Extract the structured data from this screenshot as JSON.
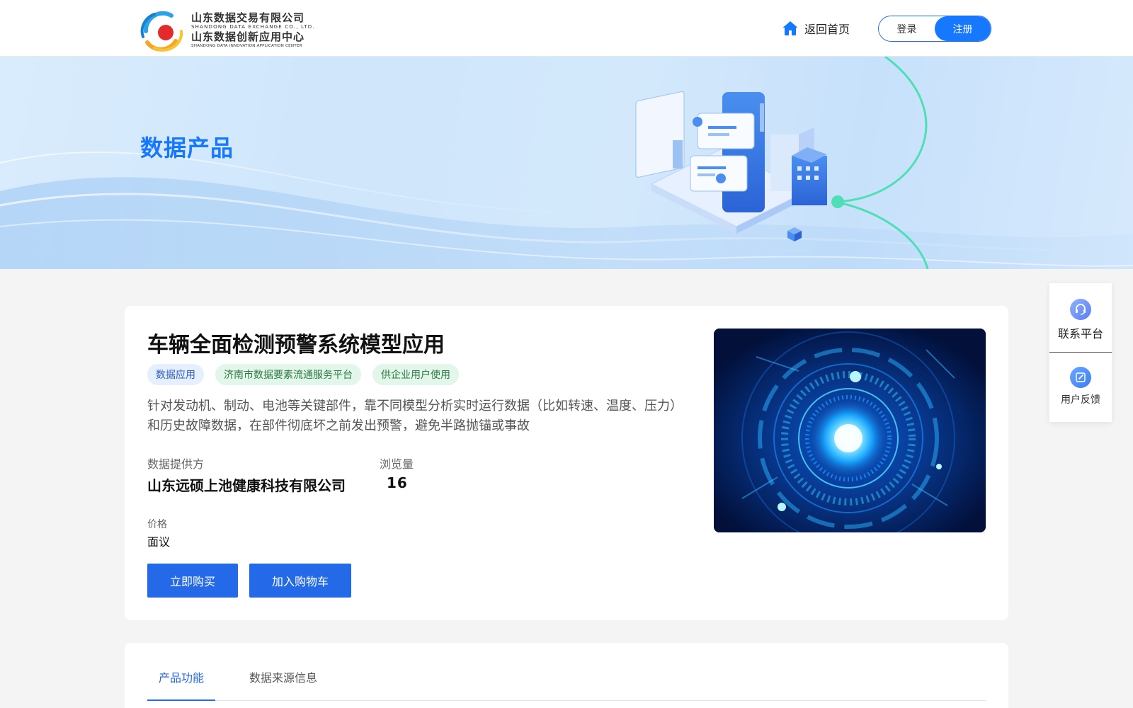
{
  "header": {
    "logo": {
      "cn_line1": "山东数据交易有限公司",
      "en_line1": "SHANDONG DATA EXCHANGE CO., LTD.",
      "cn_line2": "山东数据创新应用中心",
      "en_line2": "SHANDONG DATA INNOVATION APPLICATION CENTER"
    },
    "home_label": "返回首页",
    "login_label": "登录",
    "register_label": "注册"
  },
  "banner": {
    "title": "数据产品"
  },
  "product": {
    "title": "车辆全面检测预警系统模型应用",
    "tags": [
      "数据应用",
      "济南市数据要素流通服务平台",
      "供企业用户使用"
    ],
    "description": "针对发动机、制动、电池等关键部件，靠不同模型分析实时运行数据（比如转速、温度、压力）和历史故障数据，在部件彻底坏之前发出预警，避免半路抛锚或事故",
    "provider_label": "数据提供方",
    "provider_value": "山东远硕上池健康科技有限公司",
    "views_label": "浏览量",
    "views_value": "16",
    "price_label": "价格",
    "price_value": "面议",
    "buy_label": "立即购买",
    "cart_label": "加入购物车"
  },
  "tabs": [
    {
      "label": "产品功能",
      "active": true
    },
    {
      "label": "数据来源信息",
      "active": false
    }
  ],
  "float_panel": {
    "contact_label": "联系平台",
    "feedback_label": "用户反馈"
  },
  "colors": {
    "accent": "#1677ff",
    "button": "#2469e8"
  }
}
